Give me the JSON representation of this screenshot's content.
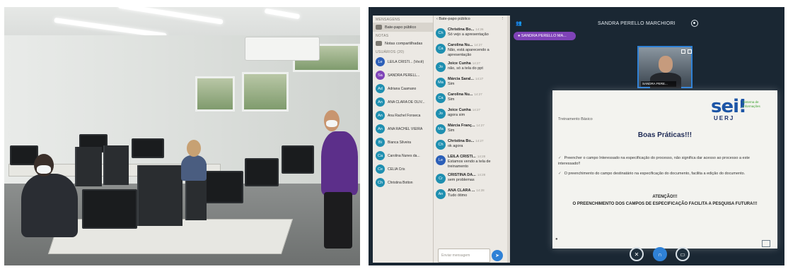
{
  "sidebar": {
    "messages_header": "MENSAGENS",
    "public_chat": "Bate-papo público",
    "notes_header": "NOTAS",
    "shared_notes": "Notas compartilhadas",
    "users_header": "USUÁRIOS (20)",
    "users": [
      {
        "initials": "Le",
        "name": "LEILA CRISTI... (Você)",
        "color": "#2c5fb8"
      },
      {
        "initials": "Sa",
        "name": "SANDRA PERELL...",
        "color": "#7f43b8"
      },
      {
        "initials": "Ad",
        "name": "Adriana Caamano",
        "color": "#1f8fb0"
      },
      {
        "initials": "An",
        "name": "ANA CLARA DE OLIV...",
        "color": "#1f8fb0"
      },
      {
        "initials": "An",
        "name": "Ana Rachel Fonseca",
        "color": "#1f8fb0"
      },
      {
        "initials": "An",
        "name": "ANA RACHEL VIEIRA",
        "color": "#1f8fb0"
      },
      {
        "initials": "Bi",
        "name": "Bianca Silveira",
        "color": "#1f8fb0"
      },
      {
        "initials": "Ca",
        "name": "Carolina Nunes da...",
        "color": "#1f8fb0"
      },
      {
        "initials": "Ce",
        "name": "CELIA Cris",
        "color": "#1f8fb0"
      },
      {
        "initials": "Ch",
        "name": "Christina Botton",
        "color": "#1f8fb0"
      }
    ]
  },
  "chat": {
    "back_label": "Bate-papo público",
    "menu_icon": "more-vertical-icon",
    "messages": [
      {
        "initials": "Ch",
        "name": "Christina Bo...",
        "time": "14:26",
        "text": "Só vejo a apresentação",
        "color": "#1f8fb0"
      },
      {
        "initials": "Ca",
        "name": "Carolina Nu...",
        "time": "14:27",
        "text": "Não, está aparecendo a apresentação",
        "color": "#1f8fb0"
      },
      {
        "initials": "Jo",
        "name": "Joice Cunha",
        "time": "14:27",
        "text": "não, só a tela do ppt",
        "color": "#1f8fb0"
      },
      {
        "initials": "Ma",
        "name": "Márcia Saral...",
        "time": "14:27",
        "text": "Sim",
        "color": "#1f8fb0"
      },
      {
        "initials": "Ca",
        "name": "Carolina Nu...",
        "time": "14:27",
        "text": "Sim",
        "color": "#1f8fb0"
      },
      {
        "initials": "Jo",
        "name": "Joice Cunha",
        "time": "14:27",
        "text": "agora sim",
        "color": "#1f8fb0"
      },
      {
        "initials": "Ma",
        "name": "Márcia Franç...",
        "time": "14:27",
        "text": "Sim",
        "color": "#1f8fb0"
      },
      {
        "initials": "Ch",
        "name": "Christina Bo...",
        "time": "14:27",
        "text": "ok agora",
        "color": "#1f8fb0"
      },
      {
        "initials": "Le",
        "name": "LEILA CRISTI...",
        "time": "14:28",
        "text": "Estamos vendo a tela de treinamento",
        "color": "#2c5fb8"
      },
      {
        "initials": "Cr",
        "name": "CRISTINA DA...",
        "time": "14:28",
        "text": "sem problemas",
        "color": "#1f8fb0"
      },
      {
        "initials": "An",
        "name": "ANA CLARA ...",
        "time": "14:28",
        "text": "Tudo ótimo",
        "color": "#1f8fb0"
      }
    ],
    "input_placeholder": "Enviar mensagem"
  },
  "topbar": {
    "room_name": "SANDRA PERELLO MARCHIORI",
    "presenter_pill": "SANDRA PERELLO MA..."
  },
  "webcam": {
    "label": "SANDRA PERE..."
  },
  "slide": {
    "tag": "Treinamento Básico",
    "logo_main": "sei",
    "logo_bottom": "UERJ",
    "logo_sub": "Sistema de Informações",
    "title": "Boas Práticas!!!",
    "bullets": [
      "Preencher o campo Interessado na especificação do processo, não significa dar acesso ao processo a este interessado!!",
      "O preenchimento do campo destinatário na especificação do documento, facilita a edição do documento."
    ],
    "attention_title": "ATENÇÃO!!!",
    "attention_text": "O PREENCHIMENTO DOS CAMPOS DE ESPECIFICAÇÃO  FACILITA A PESQUISA FUTURA!!!"
  },
  "controls": {
    "mic": "muted-microphone-icon",
    "audio": "headphones-icon",
    "video": "video-off-icon"
  },
  "colors": {
    "accent_blue": "#2f81d6",
    "presenter_purple": "#7f43b8",
    "screen_bg": "#1a2733"
  }
}
